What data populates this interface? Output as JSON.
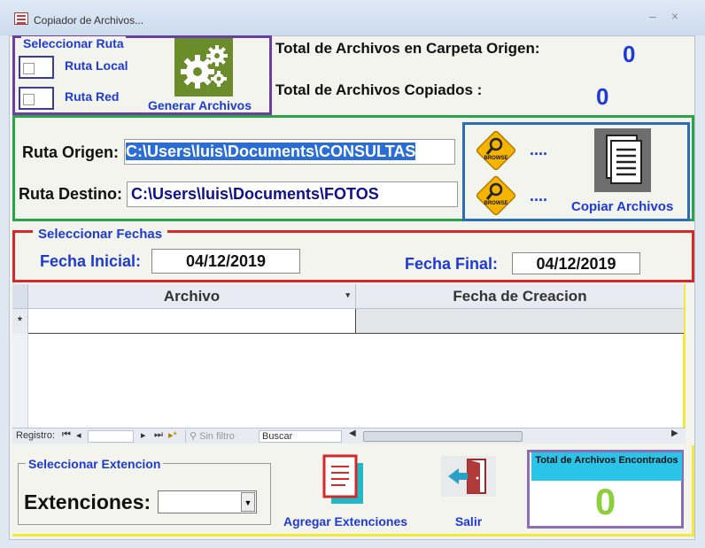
{
  "window": {
    "title": "Copiador de Archivos...",
    "minimize": "–",
    "close": "×"
  },
  "ruta": {
    "group_label": "Seleccionar Ruta",
    "local_label": "Ruta Local",
    "red_label": "Ruta Red",
    "generar_label": "Generar Archivos"
  },
  "totals": {
    "origen_label": "Total de Archivos en Carpeta Origen:",
    "origen_value": "0",
    "copiados_label": "Total de Archivos Copiados :",
    "copiados_value": "0"
  },
  "paths": {
    "origen_label": "Ruta Origen:",
    "origen_value": "C:\\Users\\luis\\Documents\\CONSULTAS",
    "destino_label": "Ruta Destino:",
    "destino_value": "C:\\Users\\luis\\Documents\\FOTOS",
    "browse_text": "BROWSE",
    "dots": "....",
    "copiar_label": "Copiar Archivos"
  },
  "fechas": {
    "group_label": "Seleccionar Fechas",
    "inicial_label": "Fecha Inicial:",
    "inicial_value": "04/12/2019",
    "final_label": "Fecha Final:",
    "final_value": "04/12/2019"
  },
  "grid": {
    "columns": [
      "Archivo",
      "Fecha de  Creacion"
    ],
    "new_row_marker": "*",
    "nav": {
      "record_label": "Registro:",
      "filter_label": "Sin filtro",
      "search_placeholder": "Buscar",
      "first": "⏮",
      "prev": "◂",
      "next": "▸",
      "last": "⏭",
      "new": "▸*"
    }
  },
  "extensiones": {
    "group_label": "Seleccionar Extencion",
    "label": "Extenciones:",
    "selected": "",
    "agregar_label": "Agregar Extenciones",
    "salir_label": "Salir"
  },
  "encontrados": {
    "label": "Total de Archivos Encontrados",
    "value": "0"
  },
  "colors": {
    "accent_blue": "#1e3ad4",
    "purple": "#6a3fa0",
    "green": "#2aa34a",
    "red": "#d62828",
    "yellow": "#f2e93a",
    "teal": "#29c4e8",
    "count_green": "#8ccf3c"
  }
}
